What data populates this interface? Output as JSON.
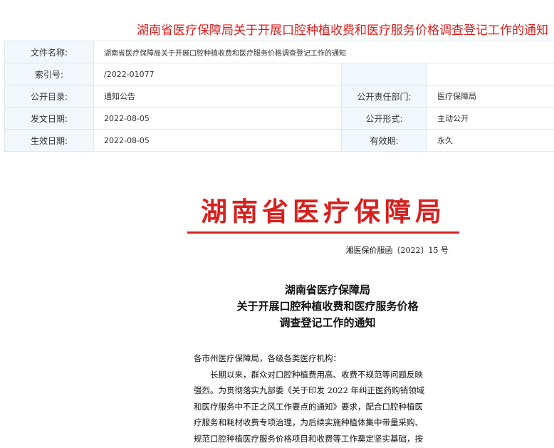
{
  "page": {
    "title": "湖南省医疗保障局关于开展口腔种植收费和医疗服务价格调查登记工作的通知"
  },
  "meta_table": {
    "rows": [
      {
        "label": "文件名称:",
        "value": "湖南省医疗保障局关于开展口腔种植收费和医疗服务价格调查登记工作的通知"
      },
      {
        "label": "索引号:",
        "value": "/2022-01077",
        "label2": "",
        "value2": ""
      },
      {
        "label": "公开目录:",
        "value": "通知公告",
        "label2": "公开责任部门:",
        "value2": "医疗保障局"
      },
      {
        "label": "发文日期:",
        "value": "2022-08-05",
        "label2": "公开形式:",
        "value2": "主动公开"
      },
      {
        "label": "生效日期:",
        "value": "2022-08-05",
        "label2": "有效期:",
        "value2": "永久"
      }
    ]
  },
  "document": {
    "agency_header": "湖南省医疗保障局",
    "doc_number": "湘医保价服函〔2022〕15 号",
    "title_lines": [
      "湖南省医疗保障局",
      "关于开展口腔种植收费和医疗服务价格",
      "调查登记工作的通知"
    ],
    "salutation": "各市州医疗保障局，各级各类医疗机构：",
    "body_lines": [
      "长期以来，群众对口腔种植费用高、收费不规范等问题反映",
      "强烈。为贯彻落实九部委《关于印发 2022 年纠正医药购销领域",
      "和医疗服务中不正之风工作要点的通知》要求，配合口腔种植医",
      "疗服务和耗材收费专项治理，为后续实施种植体集中带量采购、",
      "规范口腔种植医疗服务价格项目和收费等工作奠定坚实基础，按"
    ]
  },
  "colors": {
    "accent_red": "#d7211f",
    "label_bg": "#f2f7fc",
    "border": "#dde6f0"
  }
}
